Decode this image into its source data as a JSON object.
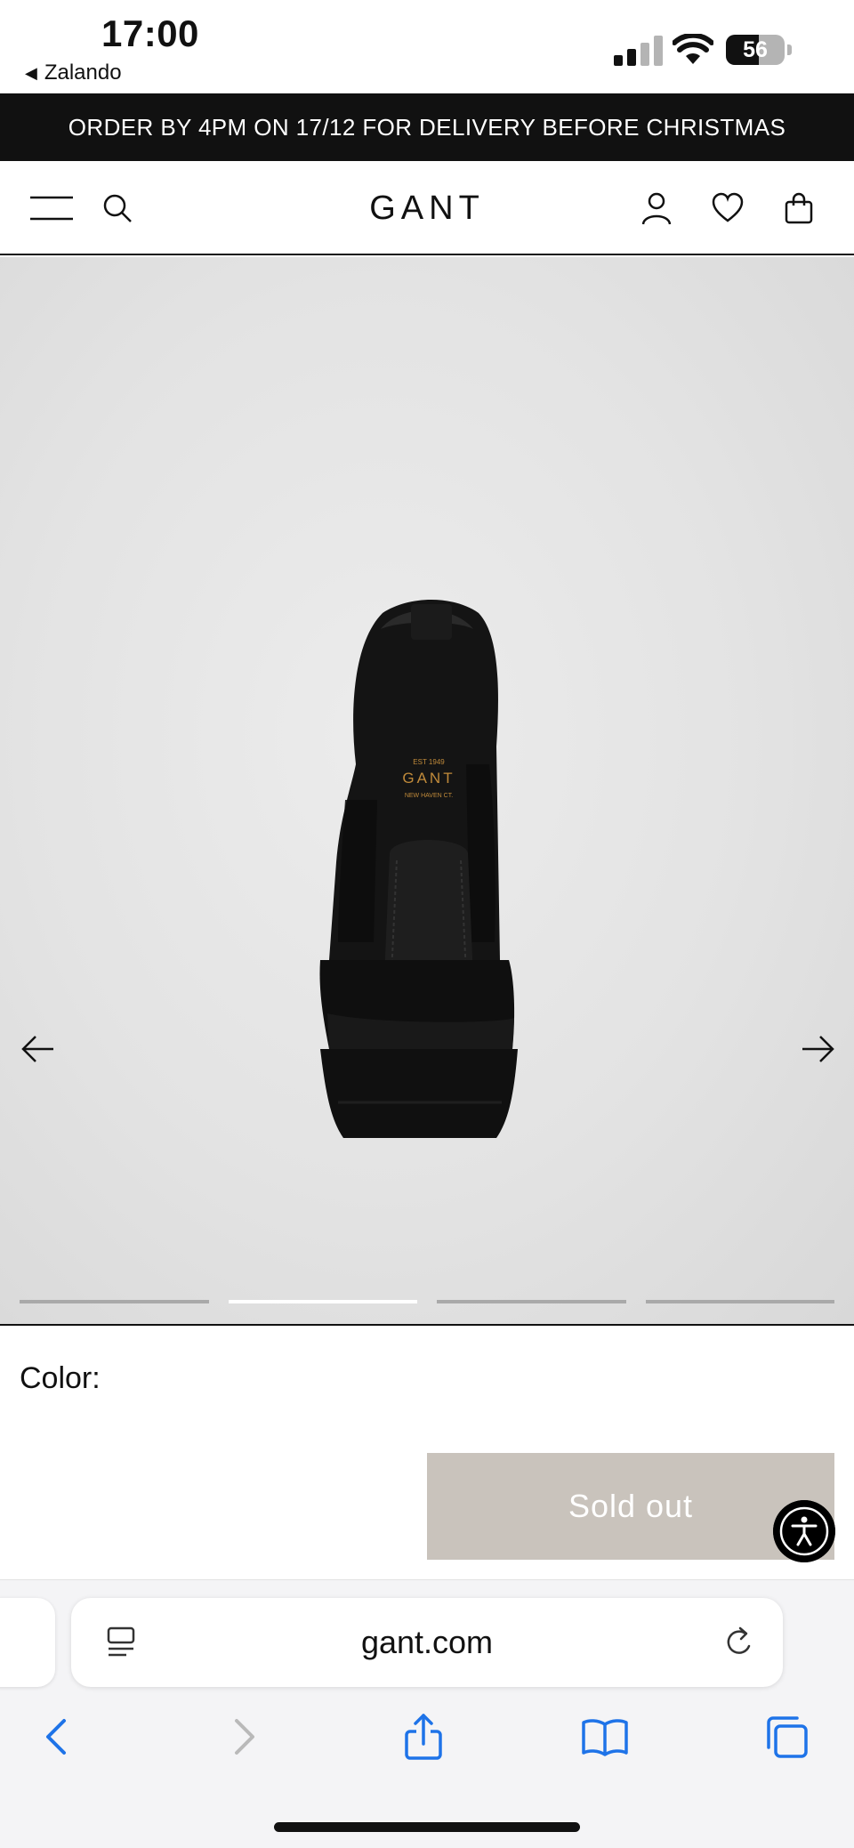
{
  "status_bar": {
    "time": "17:00",
    "back_app": "Zalando",
    "battery": {
      "level": 56,
      "label": "56"
    },
    "icons": [
      "cellular-signal-icon",
      "wifi-icon",
      "battery-icon"
    ]
  },
  "promo": {
    "text": "ORDER BY 4PM ON 17/12 FOR DELIVERY BEFORE CHRISTMAS"
  },
  "header": {
    "logo": "GANT",
    "icons": [
      "menu-icon",
      "search-icon",
      "account-icon",
      "wishlist-heart-icon",
      "shopping-bag-icon"
    ]
  },
  "gallery": {
    "image_count": 4,
    "active_index": 1,
    "icons": [
      "arrow-left-icon",
      "arrow-right-icon"
    ],
    "product_logo": {
      "est": "EST 1949",
      "brand": "GANT",
      "place": "NEW HAVEN CT."
    }
  },
  "product": {
    "color_label": "Color:",
    "button_label": "Sold out"
  },
  "browser": {
    "url": "gant.com",
    "icons": [
      "page-menu-icon",
      "reload-icon",
      "back-icon",
      "forward-icon",
      "share-icon",
      "bookmarks-icon",
      "tabs-icon"
    ]
  },
  "colors": {
    "promo_bg": "#111111",
    "sold_out_bg": "#c9c3bc",
    "link_blue": "#1e73e8"
  }
}
